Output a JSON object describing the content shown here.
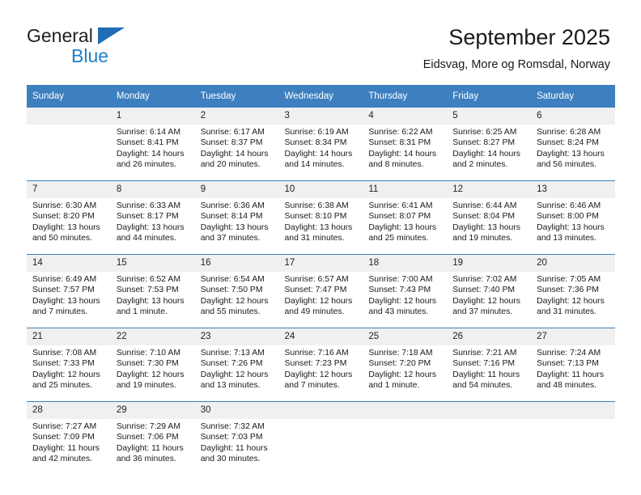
{
  "brand": {
    "name_part1": "General",
    "name_part2": "Blue"
  },
  "header": {
    "month_title": "September 2025",
    "location": "Eidsvag, More og Romsdal, Norway"
  },
  "colors": {
    "header_blue": "#3d7fbf",
    "brand_blue": "#1f7fc4",
    "daynum_band": "#f0f0f0",
    "text": "#1a1a1a"
  },
  "weekdays": [
    "Sunday",
    "Monday",
    "Tuesday",
    "Wednesday",
    "Thursday",
    "Friday",
    "Saturday"
  ],
  "weeks": [
    [
      {
        "day": "",
        "empty": true,
        "sunrise": "",
        "sunset": "",
        "daylight_line1": "",
        "daylight_line2": ""
      },
      {
        "day": "1",
        "sunrise": "Sunrise: 6:14 AM",
        "sunset": "Sunset: 8:41 PM",
        "daylight_line1": "Daylight: 14 hours",
        "daylight_line2": "and 26 minutes."
      },
      {
        "day": "2",
        "sunrise": "Sunrise: 6:17 AM",
        "sunset": "Sunset: 8:37 PM",
        "daylight_line1": "Daylight: 14 hours",
        "daylight_line2": "and 20 minutes."
      },
      {
        "day": "3",
        "sunrise": "Sunrise: 6:19 AM",
        "sunset": "Sunset: 8:34 PM",
        "daylight_line1": "Daylight: 14 hours",
        "daylight_line2": "and 14 minutes."
      },
      {
        "day": "4",
        "sunrise": "Sunrise: 6:22 AM",
        "sunset": "Sunset: 8:31 PM",
        "daylight_line1": "Daylight: 14 hours",
        "daylight_line2": "and 8 minutes."
      },
      {
        "day": "5",
        "sunrise": "Sunrise: 6:25 AM",
        "sunset": "Sunset: 8:27 PM",
        "daylight_line1": "Daylight: 14 hours",
        "daylight_line2": "and 2 minutes."
      },
      {
        "day": "6",
        "sunrise": "Sunrise: 6:28 AM",
        "sunset": "Sunset: 8:24 PM",
        "daylight_line1": "Daylight: 13 hours",
        "daylight_line2": "and 56 minutes."
      }
    ],
    [
      {
        "day": "7",
        "sunrise": "Sunrise: 6:30 AM",
        "sunset": "Sunset: 8:20 PM",
        "daylight_line1": "Daylight: 13 hours",
        "daylight_line2": "and 50 minutes."
      },
      {
        "day": "8",
        "sunrise": "Sunrise: 6:33 AM",
        "sunset": "Sunset: 8:17 PM",
        "daylight_line1": "Daylight: 13 hours",
        "daylight_line2": "and 44 minutes."
      },
      {
        "day": "9",
        "sunrise": "Sunrise: 6:36 AM",
        "sunset": "Sunset: 8:14 PM",
        "daylight_line1": "Daylight: 13 hours",
        "daylight_line2": "and 37 minutes."
      },
      {
        "day": "10",
        "sunrise": "Sunrise: 6:38 AM",
        "sunset": "Sunset: 8:10 PM",
        "daylight_line1": "Daylight: 13 hours",
        "daylight_line2": "and 31 minutes."
      },
      {
        "day": "11",
        "sunrise": "Sunrise: 6:41 AM",
        "sunset": "Sunset: 8:07 PM",
        "daylight_line1": "Daylight: 13 hours",
        "daylight_line2": "and 25 minutes."
      },
      {
        "day": "12",
        "sunrise": "Sunrise: 6:44 AM",
        "sunset": "Sunset: 8:04 PM",
        "daylight_line1": "Daylight: 13 hours",
        "daylight_line2": "and 19 minutes."
      },
      {
        "day": "13",
        "sunrise": "Sunrise: 6:46 AM",
        "sunset": "Sunset: 8:00 PM",
        "daylight_line1": "Daylight: 13 hours",
        "daylight_line2": "and 13 minutes."
      }
    ],
    [
      {
        "day": "14",
        "sunrise": "Sunrise: 6:49 AM",
        "sunset": "Sunset: 7:57 PM",
        "daylight_line1": "Daylight: 13 hours",
        "daylight_line2": "and 7 minutes."
      },
      {
        "day": "15",
        "sunrise": "Sunrise: 6:52 AM",
        "sunset": "Sunset: 7:53 PM",
        "daylight_line1": "Daylight: 13 hours",
        "daylight_line2": "and 1 minute."
      },
      {
        "day": "16",
        "sunrise": "Sunrise: 6:54 AM",
        "sunset": "Sunset: 7:50 PM",
        "daylight_line1": "Daylight: 12 hours",
        "daylight_line2": "and 55 minutes."
      },
      {
        "day": "17",
        "sunrise": "Sunrise: 6:57 AM",
        "sunset": "Sunset: 7:47 PM",
        "daylight_line1": "Daylight: 12 hours",
        "daylight_line2": "and 49 minutes."
      },
      {
        "day": "18",
        "sunrise": "Sunrise: 7:00 AM",
        "sunset": "Sunset: 7:43 PM",
        "daylight_line1": "Daylight: 12 hours",
        "daylight_line2": "and 43 minutes."
      },
      {
        "day": "19",
        "sunrise": "Sunrise: 7:02 AM",
        "sunset": "Sunset: 7:40 PM",
        "daylight_line1": "Daylight: 12 hours",
        "daylight_line2": "and 37 minutes."
      },
      {
        "day": "20",
        "sunrise": "Sunrise: 7:05 AM",
        "sunset": "Sunset: 7:36 PM",
        "daylight_line1": "Daylight: 12 hours",
        "daylight_line2": "and 31 minutes."
      }
    ],
    [
      {
        "day": "21",
        "sunrise": "Sunrise: 7:08 AM",
        "sunset": "Sunset: 7:33 PM",
        "daylight_line1": "Daylight: 12 hours",
        "daylight_line2": "and 25 minutes."
      },
      {
        "day": "22",
        "sunrise": "Sunrise: 7:10 AM",
        "sunset": "Sunset: 7:30 PM",
        "daylight_line1": "Daylight: 12 hours",
        "daylight_line2": "and 19 minutes."
      },
      {
        "day": "23",
        "sunrise": "Sunrise: 7:13 AM",
        "sunset": "Sunset: 7:26 PM",
        "daylight_line1": "Daylight: 12 hours",
        "daylight_line2": "and 13 minutes."
      },
      {
        "day": "24",
        "sunrise": "Sunrise: 7:16 AM",
        "sunset": "Sunset: 7:23 PM",
        "daylight_line1": "Daylight: 12 hours",
        "daylight_line2": "and 7 minutes."
      },
      {
        "day": "25",
        "sunrise": "Sunrise: 7:18 AM",
        "sunset": "Sunset: 7:20 PM",
        "daylight_line1": "Daylight: 12 hours",
        "daylight_line2": "and 1 minute."
      },
      {
        "day": "26",
        "sunrise": "Sunrise: 7:21 AM",
        "sunset": "Sunset: 7:16 PM",
        "daylight_line1": "Daylight: 11 hours",
        "daylight_line2": "and 54 minutes."
      },
      {
        "day": "27",
        "sunrise": "Sunrise: 7:24 AM",
        "sunset": "Sunset: 7:13 PM",
        "daylight_line1": "Daylight: 11 hours",
        "daylight_line2": "and 48 minutes."
      }
    ],
    [
      {
        "day": "28",
        "sunrise": "Sunrise: 7:27 AM",
        "sunset": "Sunset: 7:09 PM",
        "daylight_line1": "Daylight: 11 hours",
        "daylight_line2": "and 42 minutes."
      },
      {
        "day": "29",
        "sunrise": "Sunrise: 7:29 AM",
        "sunset": "Sunset: 7:06 PM",
        "daylight_line1": "Daylight: 11 hours",
        "daylight_line2": "and 36 minutes."
      },
      {
        "day": "30",
        "sunrise": "Sunrise: 7:32 AM",
        "sunset": "Sunset: 7:03 PM",
        "daylight_line1": "Daylight: 11 hours",
        "daylight_line2": "and 30 minutes."
      },
      {
        "day": "",
        "empty": true,
        "sunrise": "",
        "sunset": "",
        "daylight_line1": "",
        "daylight_line2": ""
      },
      {
        "day": "",
        "empty": true,
        "sunrise": "",
        "sunset": "",
        "daylight_line1": "",
        "daylight_line2": ""
      },
      {
        "day": "",
        "empty": true,
        "sunrise": "",
        "sunset": "",
        "daylight_line1": "",
        "daylight_line2": ""
      },
      {
        "day": "",
        "empty": true,
        "sunrise": "",
        "sunset": "",
        "daylight_line1": "",
        "daylight_line2": ""
      }
    ]
  ]
}
